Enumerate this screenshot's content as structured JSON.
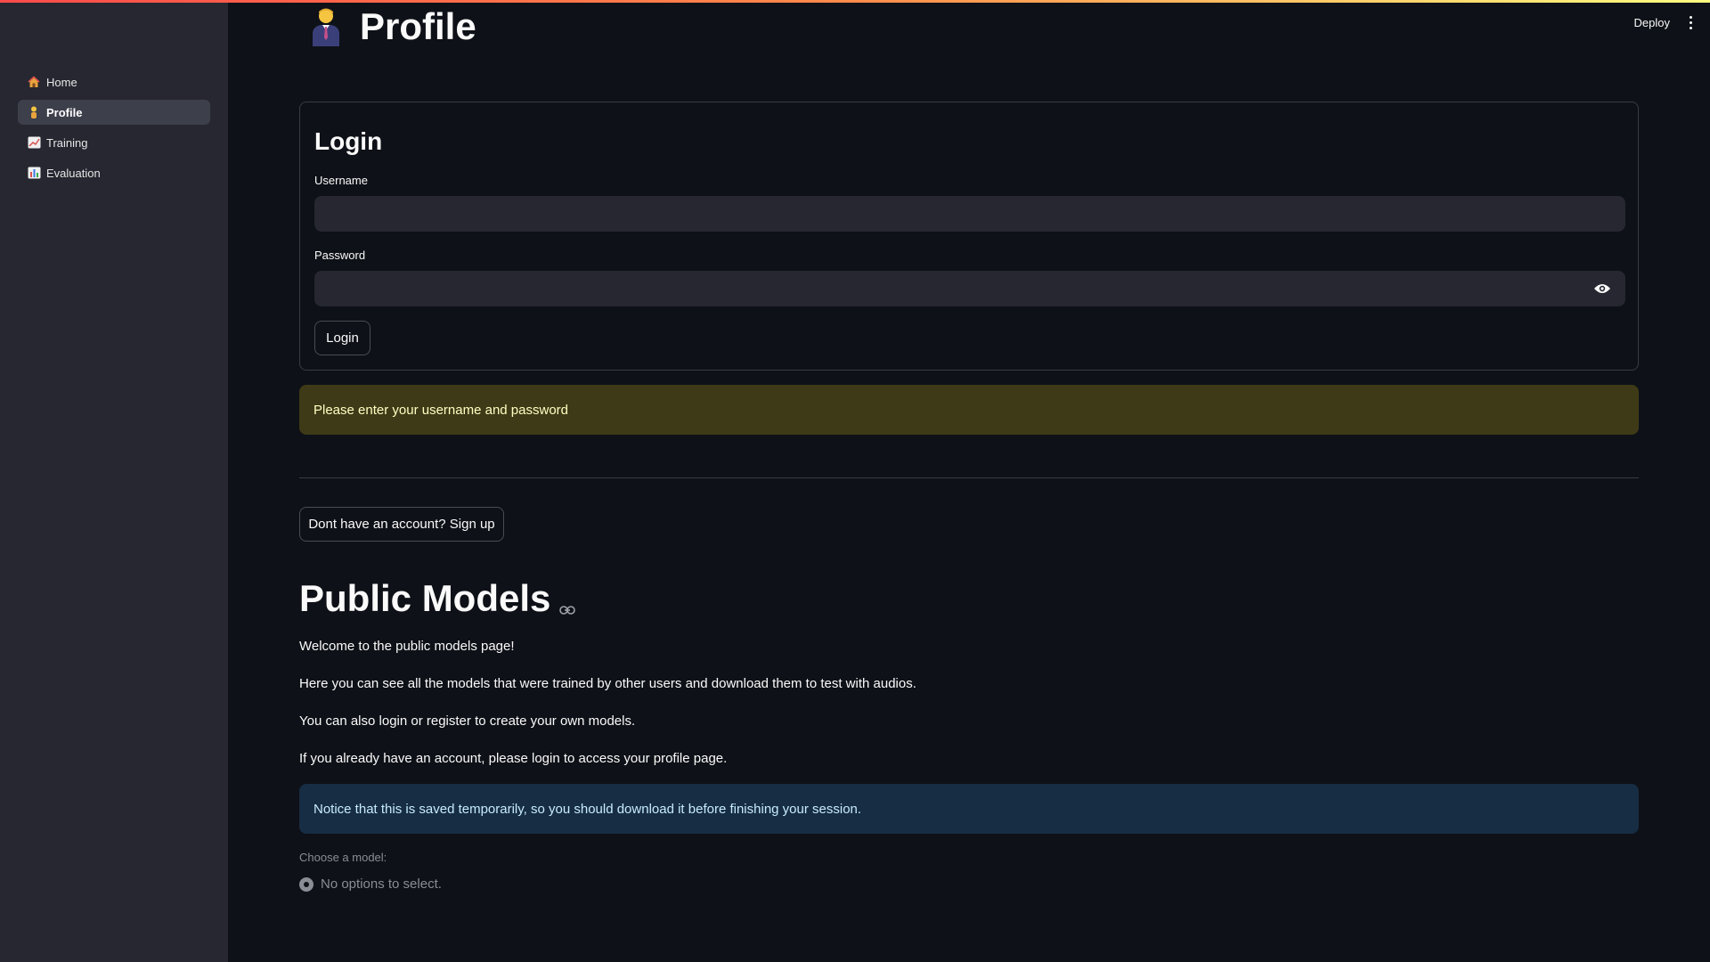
{
  "header": {
    "deploy_label": "Deploy",
    "menu_icon": "more-vertical-icon"
  },
  "sidebar": {
    "items": [
      {
        "label": "Home",
        "icon": "house-icon",
        "active": false
      },
      {
        "label": "Profile",
        "icon": "person-icon",
        "active": true
      },
      {
        "label": "Training",
        "icon": "chart-increasing-icon",
        "active": false
      },
      {
        "label": "Evaluation",
        "icon": "bar-chart-icon",
        "active": false
      }
    ]
  },
  "page": {
    "title": "Profile",
    "title_icon": "person-in-suit-icon"
  },
  "login": {
    "heading": "Login",
    "username_label": "Username",
    "username_value": "",
    "password_label": "Password",
    "password_value": "",
    "submit_label": "Login"
  },
  "warning": {
    "text": "Please enter your username and password"
  },
  "signup_button": "Dont have an account? Sign up",
  "public_models": {
    "heading": "Public Models",
    "paragraphs": [
      "Welcome to the public models page!",
      "Here you can see all the models that were trained by other users and download them to test with audios.",
      "You can also login or register to create your own models.",
      "If you already have an account, please login to access your profile page."
    ],
    "info": "Notice that this is saved temporarily, so you should download it before finishing your session.",
    "choose_label": "Choose a model:",
    "no_options": "No options to select."
  },
  "colors": {
    "background": "#0e1117",
    "sidebar": "#262730",
    "warning_bg": "#3e3a17",
    "warning_text": "#ffffc2",
    "info_bg": "#172d43",
    "info_text": "#c7ebff"
  }
}
